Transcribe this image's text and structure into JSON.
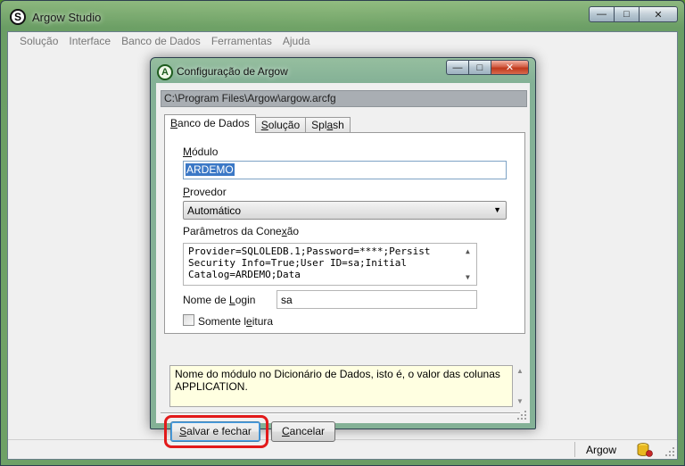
{
  "app": {
    "title": "Argow Studio",
    "icon_letter": "S"
  },
  "menubar": {
    "items": [
      "Solução",
      "Interface",
      "Banco de Dados",
      "Ferramentas",
      "Ajuda"
    ]
  },
  "statusbar": {
    "text": "Argow",
    "icon": "database-icon"
  },
  "dialog": {
    "title": "Configuração de Argow",
    "icon_letter": "A",
    "path": "C:\\Program Files\\Argow\\argow.arcfg",
    "tabs": [
      {
        "pre": "",
        "key": "B",
        "post": "anco de Dados",
        "active": true
      },
      {
        "pre": "",
        "key": "S",
        "post": "olução",
        "active": false
      },
      {
        "pre": "Spl",
        "key": "a",
        "post": "sh",
        "active": false
      }
    ],
    "modulo": {
      "label_key": "M",
      "label_rest": "ódulo",
      "value": "ARDEMO"
    },
    "provedor": {
      "label_key": "P",
      "label_rest": "rovedor",
      "value": "Automático"
    },
    "parametros": {
      "label_pre": "Parâmetros da Cone",
      "label_key": "x",
      "label_post": "ão",
      "lines": [
        "Provider=SQLOLEDB.1;Password=****;Persist",
        "Security Info=True;User ID=sa;Initial",
        "Catalog=ARDEMO;Data"
      ]
    },
    "login": {
      "label_pre": "Nome de ",
      "label_key": "L",
      "label_post": "ogin",
      "value": "sa"
    },
    "readonly": {
      "label_pre": "Somente l",
      "label_key": "e",
      "label_post": "itura",
      "checked": false
    },
    "help_text": "Nome do módulo no Dicionário de Dados, isto é, o valor das colunas APPLICATION.",
    "buttons": {
      "save": {
        "key": "S",
        "rest": "alvar e fechar"
      },
      "cancel": {
        "pre": "",
        "key": "C",
        "rest": "ancelar"
      }
    }
  },
  "colors": {
    "highlight": "#e21a1a",
    "selection": "#3b78c6",
    "help_background": "#ffffe1"
  }
}
